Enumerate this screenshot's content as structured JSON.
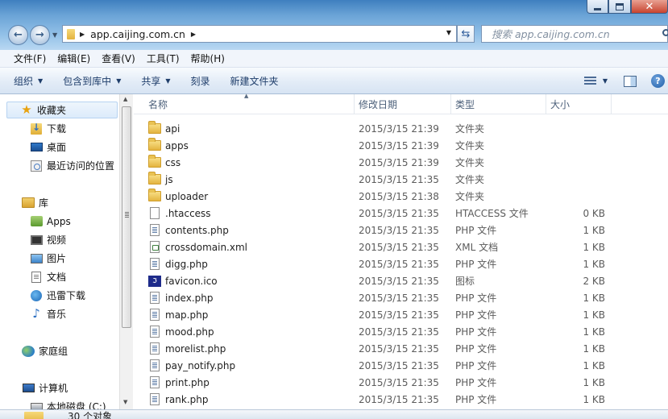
{
  "window": {
    "address_path": "app.caijing.com.cn",
    "search_placeholder": "搜索 app.caijing.com.cn",
    "accent": "#3f7fbf"
  },
  "menu": [
    "文件(F)",
    "编辑(E)",
    "查看(V)",
    "工具(T)",
    "帮助(H)"
  ],
  "toolbar": {
    "organize": "组织",
    "include_in_library": "包含到库中",
    "share": "共享",
    "burn": "刻录",
    "new_folder": "新建文件夹"
  },
  "nav": {
    "favorites_label": "收藏夹",
    "favorites": [
      {
        "label": "下载",
        "icon": "download-folder-icon"
      },
      {
        "label": "桌面",
        "icon": "desktop-icon"
      },
      {
        "label": "最近访问的位置",
        "icon": "recent-places-icon"
      }
    ],
    "libraries_label": "库",
    "libraries": [
      {
        "label": "Apps",
        "icon": "apps-library-icon"
      },
      {
        "label": "视频",
        "icon": "video-icon"
      },
      {
        "label": "图片",
        "icon": "pictures-icon"
      },
      {
        "label": "文档",
        "icon": "documents-icon"
      },
      {
        "label": "迅雷下载",
        "icon": "thunder-download-icon"
      },
      {
        "label": "音乐",
        "icon": "music-icon"
      }
    ],
    "homegroup_label": "家庭组",
    "computer_label": "计算机",
    "local_disk_label": "本地磁盘 (C:)"
  },
  "columns": {
    "name": "名称",
    "date": "修改日期",
    "type": "类型",
    "size": "大小"
  },
  "files": [
    {
      "name": "api",
      "date": "2015/3/15 21:39",
      "type": "文件夹",
      "size": "",
      "icon": "folder"
    },
    {
      "name": "apps",
      "date": "2015/3/15 21:39",
      "type": "文件夹",
      "size": "",
      "icon": "folder"
    },
    {
      "name": "css",
      "date": "2015/3/15 21:39",
      "type": "文件夹",
      "size": "",
      "icon": "folder"
    },
    {
      "name": "js",
      "date": "2015/3/15 21:35",
      "type": "文件夹",
      "size": "",
      "icon": "folder"
    },
    {
      "name": "uploader",
      "date": "2015/3/15 21:38",
      "type": "文件夹",
      "size": "",
      "icon": "folder"
    },
    {
      "name": ".htaccess",
      "date": "2015/3/15 21:35",
      "type": "HTACCESS 文件",
      "size": "0 KB",
      "icon": "blank"
    },
    {
      "name": "contents.php",
      "date": "2015/3/15 21:35",
      "type": "PHP 文件",
      "size": "1 KB",
      "icon": "php"
    },
    {
      "name": "crossdomain.xml",
      "date": "2015/3/15 21:35",
      "type": "XML 文档",
      "size": "1 KB",
      "icon": "xml"
    },
    {
      "name": "digg.php",
      "date": "2015/3/15 21:35",
      "type": "PHP 文件",
      "size": "1 KB",
      "icon": "php"
    },
    {
      "name": "favicon.ico",
      "date": "2015/3/15 21:35",
      "type": "图标",
      "size": "2 KB",
      "icon": "ico"
    },
    {
      "name": "index.php",
      "date": "2015/3/15 21:35",
      "type": "PHP 文件",
      "size": "1 KB",
      "icon": "php"
    },
    {
      "name": "map.php",
      "date": "2015/3/15 21:35",
      "type": "PHP 文件",
      "size": "1 KB",
      "icon": "php"
    },
    {
      "name": "mood.php",
      "date": "2015/3/15 21:35",
      "type": "PHP 文件",
      "size": "1 KB",
      "icon": "php"
    },
    {
      "name": "morelist.php",
      "date": "2015/3/15 21:35",
      "type": "PHP 文件",
      "size": "1 KB",
      "icon": "php"
    },
    {
      "name": "pay_notify.php",
      "date": "2015/3/15 21:35",
      "type": "PHP 文件",
      "size": "1 KB",
      "icon": "php"
    },
    {
      "name": "print.php",
      "date": "2015/3/15 21:35",
      "type": "PHP 文件",
      "size": "1 KB",
      "icon": "php"
    },
    {
      "name": "rank.php",
      "date": "2015/3/15 21:35",
      "type": "PHP 文件",
      "size": "1 KB",
      "icon": "php"
    }
  ],
  "status": {
    "item_count": "30 个对象"
  }
}
